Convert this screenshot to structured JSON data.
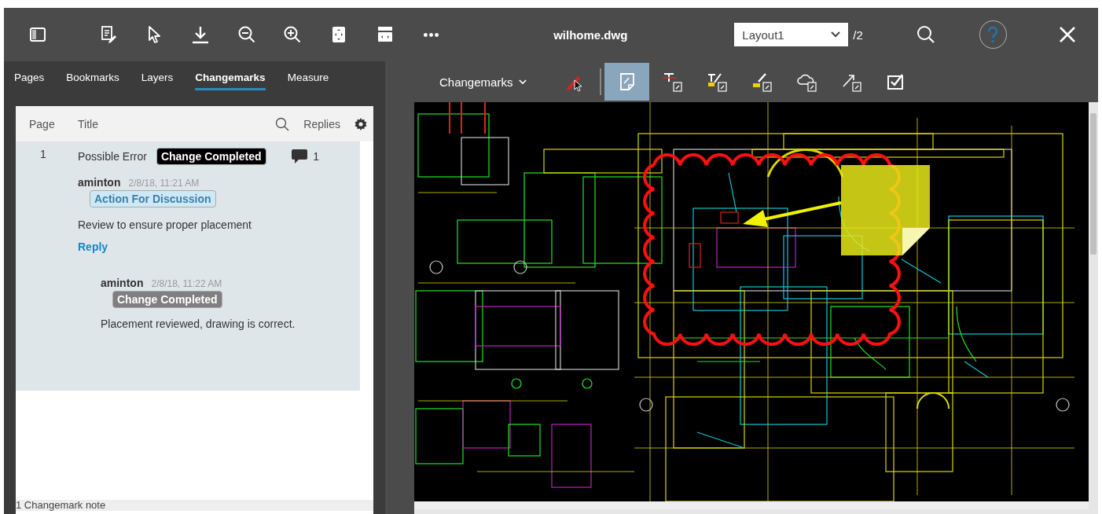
{
  "toolbar": {
    "file_name": "wilhome.dwg",
    "layout": "Layout1",
    "page_total": "/2"
  },
  "sidebar": {
    "tabs": [
      {
        "label": "Pages",
        "selected": false
      },
      {
        "label": "Bookmarks",
        "selected": false
      },
      {
        "label": "Layers",
        "selected": false
      },
      {
        "label": "Changemarks",
        "selected": true
      },
      {
        "label": "Measure",
        "selected": false
      }
    ],
    "columns": {
      "page": "Page",
      "title": "Title",
      "replies": "Replies"
    },
    "items": [
      {
        "page": "1",
        "title": "Possible Error",
        "status": {
          "text": "Change Completed",
          "color": "#000000"
        },
        "reply_count": "1",
        "selected": true,
        "note": {
          "author": "aminton",
          "time": "2/8/18, 11:21 AM",
          "tag": {
            "text": "Action For Discussion",
            "color": "#cfe8f6"
          },
          "body": "Review to ensure proper placement"
        },
        "reply_link": "Reply",
        "replies": [
          {
            "author": "aminton",
            "time": "2/8/18, 11:22 AM",
            "tag": {
              "text": "Change Completed",
              "color": "#7f7f7f"
            },
            "body": "Placement reviewed, drawing is correct."
          }
        ]
      }
    ],
    "footer": "1 Changemark note"
  },
  "markup_toolbar": {
    "mode": "Changemarks",
    "tools": [
      {
        "kind": "pen-pointer",
        "selected": false
      },
      {
        "kind": "note",
        "selected": true
      },
      {
        "kind": "strikeout",
        "selected": false
      },
      {
        "kind": "replace-text",
        "selected": false
      },
      {
        "kind": "highlight",
        "selected": false
      },
      {
        "kind": "cloud",
        "selected": false
      },
      {
        "kind": "arrow",
        "selected": false
      },
      {
        "kind": "checkbox",
        "selected": false
      }
    ]
  }
}
